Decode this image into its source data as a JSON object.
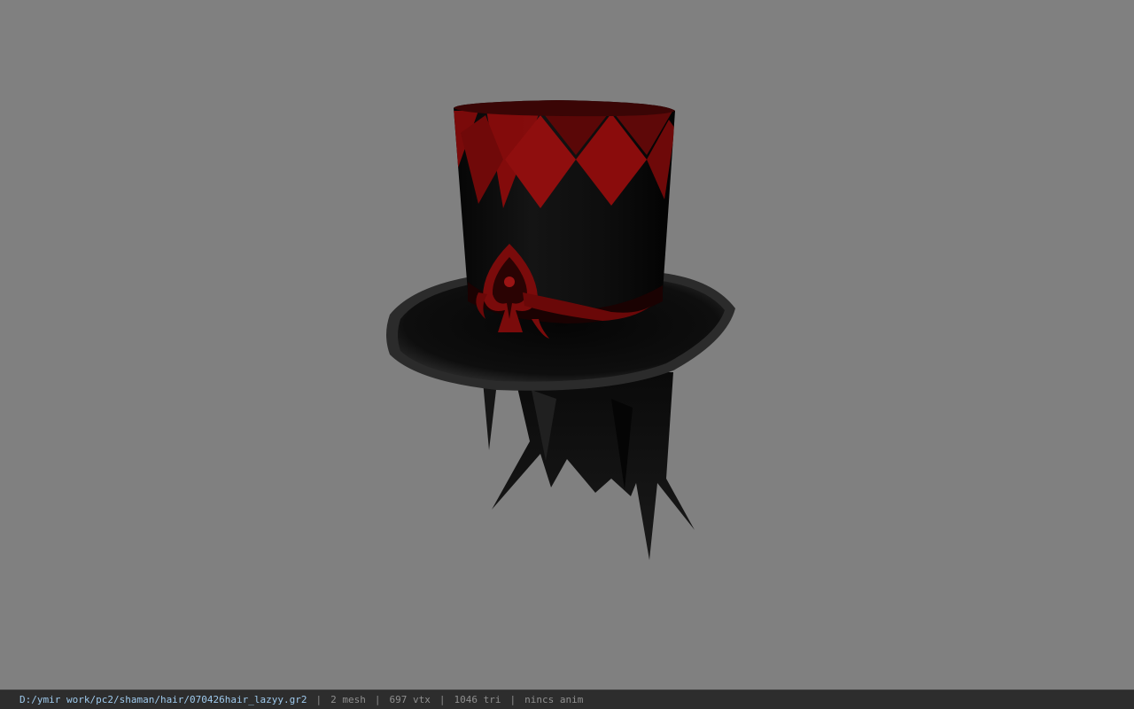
{
  "viewport": {
    "object": "hair-model",
    "background_color": "#808080"
  },
  "statusbar": {
    "file_path": "D:/ymir work/pc2/shaman/hair/070426hair_lazyy.gr2",
    "separator": "|",
    "mesh": "2 mesh",
    "vertices": "697 vtx",
    "triangles": "1046 tri",
    "animation": "nincs anim"
  },
  "colors": {
    "hat_black": "#0b0b0b",
    "hat_red": "#8a0c0c",
    "status_path": "#9ec9ec"
  }
}
